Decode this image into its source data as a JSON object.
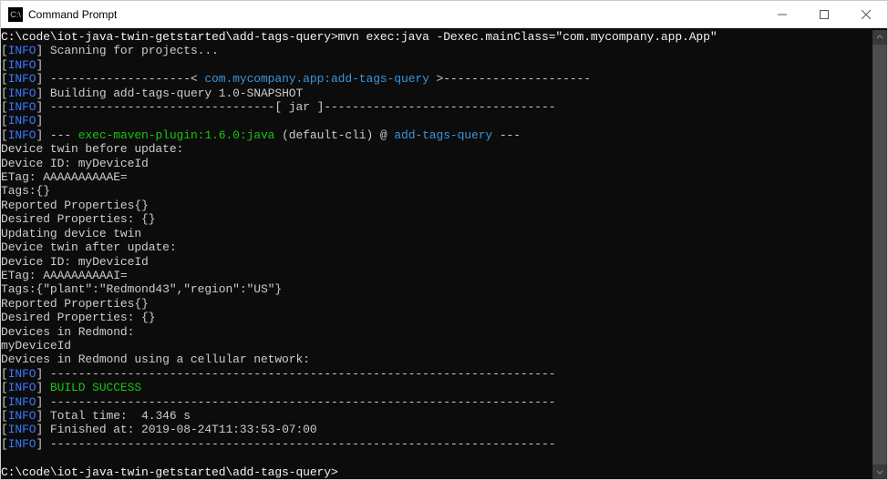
{
  "window": {
    "title": "Command Prompt",
    "icon_text": "C:\\"
  },
  "prompt": {
    "path": "C:\\code\\iot-java-twin-getstarted\\add-tags-query>",
    "command": "mvn exec:java -Dexec.mainClass=\"com.mycompany.app.App\""
  },
  "log": {
    "info_tag": "INFO",
    "scanning": "Scanning for projects...",
    "dash_dotted1": "--------------------",
    "artifact": "com.mycompany.app:add-tags-query",
    "dash_dotted2": "---------------------",
    "building": "Building add-tags-query 1.0-SNAPSHOT",
    "jar_line": "--------------------------------[ jar ]---------------------------------",
    "plugin_dash": "--- ",
    "plugin_name": "exec-maven-plugin:1.6.0:java",
    "plugin_default": " (default-cli) @ ",
    "plugin_target": "add-tags-query",
    "plugin_trail": " ---"
  },
  "output": {
    "l1": "Device twin before update:",
    "l2": "Device ID: myDeviceId",
    "l3": "ETag: AAAAAAAAAAE=",
    "l4": "Tags:{}",
    "l5": "Reported Properties{}",
    "l6": "Desired Properties: {}",
    "l7": "",
    "l8": "Updating device twin",
    "l9": "Device twin after update:",
    "l10": "Device ID: myDeviceId",
    "l11": "ETag: AAAAAAAAAAI=",
    "l12": "Tags:{\"plant\":\"Redmond43\",\"region\":\"US\"}",
    "l13": "Reported Properties{}",
    "l14": "Desired Properties: {}",
    "l15": "",
    "l16": "Devices in Redmond:",
    "l17": "myDeviceId",
    "l18": "Devices in Redmond using a cellular network:"
  },
  "footer": {
    "dash_long": "------------------------------------------------------------------------",
    "build_success": "BUILD SUCCESS",
    "total_time": "Total time:  4.346 s",
    "finished": "Finished at: 2019-08-24T11:33:53-07:00"
  },
  "prompt2": {
    "path": "C:\\code\\iot-java-twin-getstarted\\add-tags-query>"
  }
}
